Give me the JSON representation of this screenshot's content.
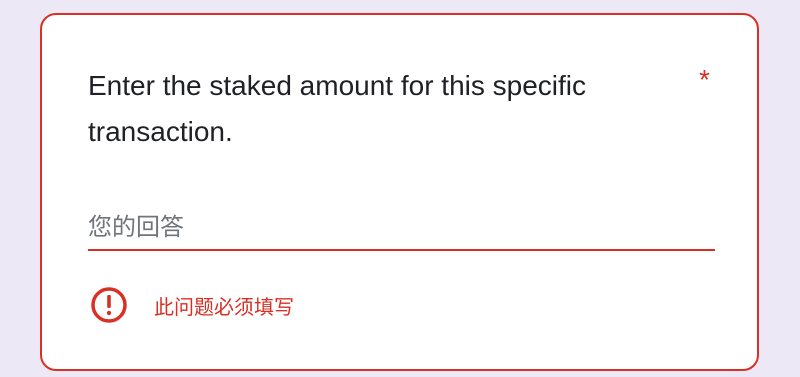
{
  "question": {
    "title": "Enter the staked amount for this specific transaction.",
    "required_marker": "*"
  },
  "answer": {
    "placeholder": "您的回答",
    "value": ""
  },
  "error": {
    "icon": "error-circle-icon",
    "message": "此问题必须填写"
  },
  "colors": {
    "page_background": "#ede8f6",
    "card_background": "#ffffff",
    "error_accent": "#d93025",
    "text": "#202124",
    "placeholder": "#70757a"
  }
}
